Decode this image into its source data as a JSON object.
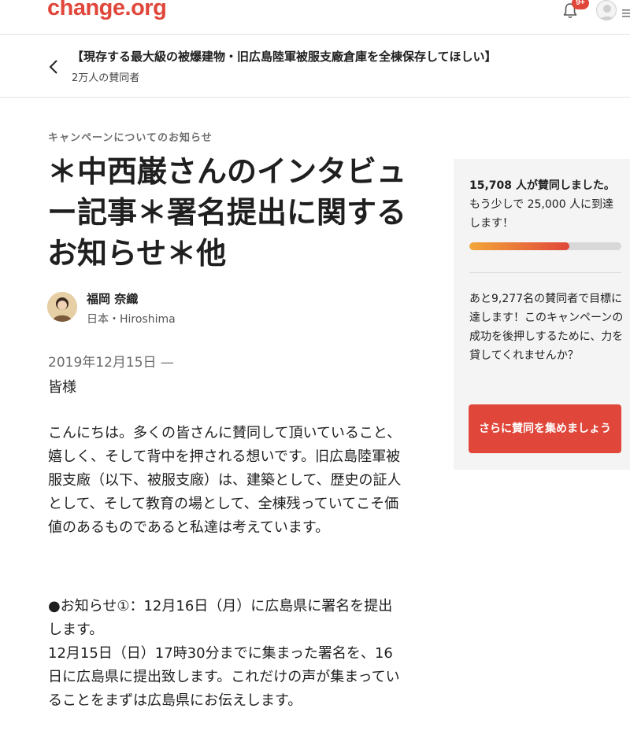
{
  "header": {
    "logo": "change.org",
    "notification_badge": "9+"
  },
  "petition": {
    "title": "【現存する最大級の被爆建物・旧広島陸軍被服支廠倉庫を全棟保存してほしい】",
    "supporters": "2万人の賛同者"
  },
  "update": {
    "eyebrow": "キャンペーンについてのお知らせ",
    "headline": "＊中西巌さんのインタビュー記事＊署名提出に関するお知らせ＊他",
    "author_name": "福岡 奈織",
    "author_location": "日本・Hiroshima",
    "date": "2019年12月15日 —",
    "greeting": "皆様",
    "paragraph1": "こんにちは。多くの皆さんに賛同して頂いていること、嬉しく、そして背中を押される想いです。旧広島陸軍被服支廠（以下、被服支廠）は、建築として、歴史の証人として、そして教育の場として、全棟残っていてこそ価値のあるものであると私達は考えています。",
    "paragraph2_line1": "●お知らせ①：12月16日（月）に広島県に署名を提出します。",
    "paragraph2_line2": "12月15日（日）17時30分までに集まった署名を、16日に広島県に提出致します。これだけの声が集まっていることをまずは広島県にお伝えします。"
  },
  "sidebar": {
    "signed_bold": "15,708 人が賛同しました。",
    "signed_rest": "もう少しで 25,000 人に到達します！",
    "progress_fraction": 0.66,
    "remaining": "あと9,277名の賛同者で目標に達します！このキャンペーンの成功を後押しするために、力を貸してくれませんか？",
    "cta_label": "さらに賛同を集めましょう"
  },
  "colors": {
    "brand": "#e0463a",
    "progress_start": "#f2a63a"
  }
}
